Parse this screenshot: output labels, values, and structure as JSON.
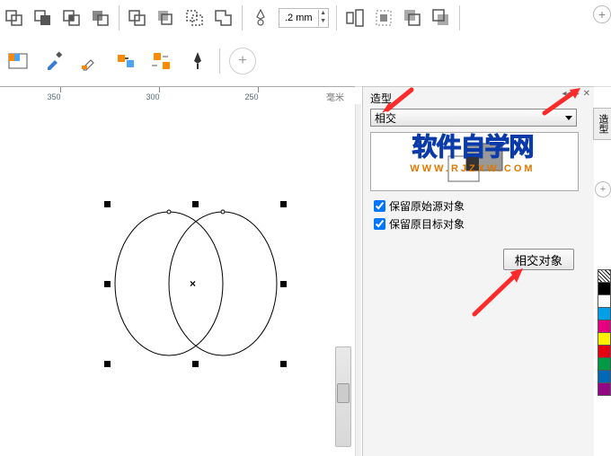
{
  "toolbar1": {
    "outline_width": ".2 mm"
  },
  "toolbar2": {},
  "ruler": {
    "ticks": [
      "350",
      "300",
      "250"
    ],
    "unit": "毫米"
  },
  "docker": {
    "title": "造型",
    "dropdown_value": "相交",
    "checkbox1": "保留原始源对象",
    "checkbox2": "保留原目标对象",
    "action": "相交对象",
    "tab_label": "造型"
  },
  "watermark": {
    "line1": "软件自学网",
    "line2": "WWW.RJZXW.COM"
  },
  "swatches": [
    "#000000",
    "#ffffff",
    "#00a0e9",
    "#e4007f",
    "#fff100",
    "#e60012",
    "#009944",
    "#0068b7",
    "#920783"
  ]
}
